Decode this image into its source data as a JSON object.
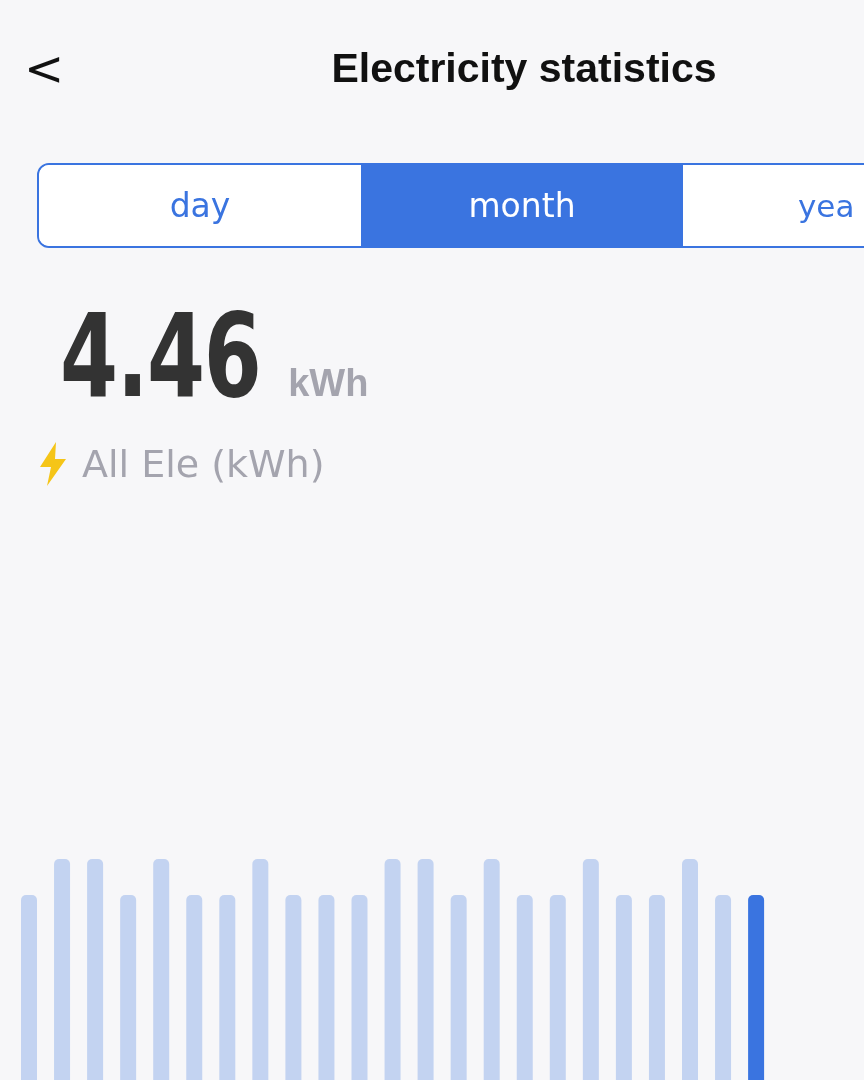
{
  "header": {
    "back": "<",
    "title": "Electricity statistics"
  },
  "tabs": [
    {
      "label": "day",
      "selected": false
    },
    {
      "label": "month",
      "selected": true
    },
    {
      "label": "yea",
      "selected": false
    }
  ],
  "total": {
    "value": "4.46",
    "unit": "kWh",
    "caption": "All Ele (kWh)"
  },
  "chart": {
    "kind": "picture",
    "bars": [
      {
        "tall": false,
        "selected": false
      },
      {
        "tall": true,
        "selected": false
      },
      {
        "tall": true,
        "selected": false
      },
      {
        "tall": false,
        "selected": false
      },
      {
        "tall": true,
        "selected": false
      },
      {
        "tall": false,
        "selected": false
      },
      {
        "tall": false,
        "selected": false
      },
      {
        "tall": true,
        "selected": false
      },
      {
        "tall": false,
        "selected": false
      },
      {
        "tall": false,
        "selected": false
      },
      {
        "tall": false,
        "selected": false
      },
      {
        "tall": true,
        "selected": false
      },
      {
        "tall": true,
        "selected": false
      },
      {
        "tall": false,
        "selected": false
      },
      {
        "tall": true,
        "selected": false
      },
      {
        "tall": false,
        "selected": false
      },
      {
        "tall": false,
        "selected": false
      },
      {
        "tall": true,
        "selected": false
      },
      {
        "tall": false,
        "selected": false
      },
      {
        "tall": false,
        "selected": false
      },
      {
        "tall": true,
        "selected": false
      },
      {
        "tall": false,
        "selected": false
      },
      {
        "tall": false,
        "selected": true
      }
    ]
  }
}
